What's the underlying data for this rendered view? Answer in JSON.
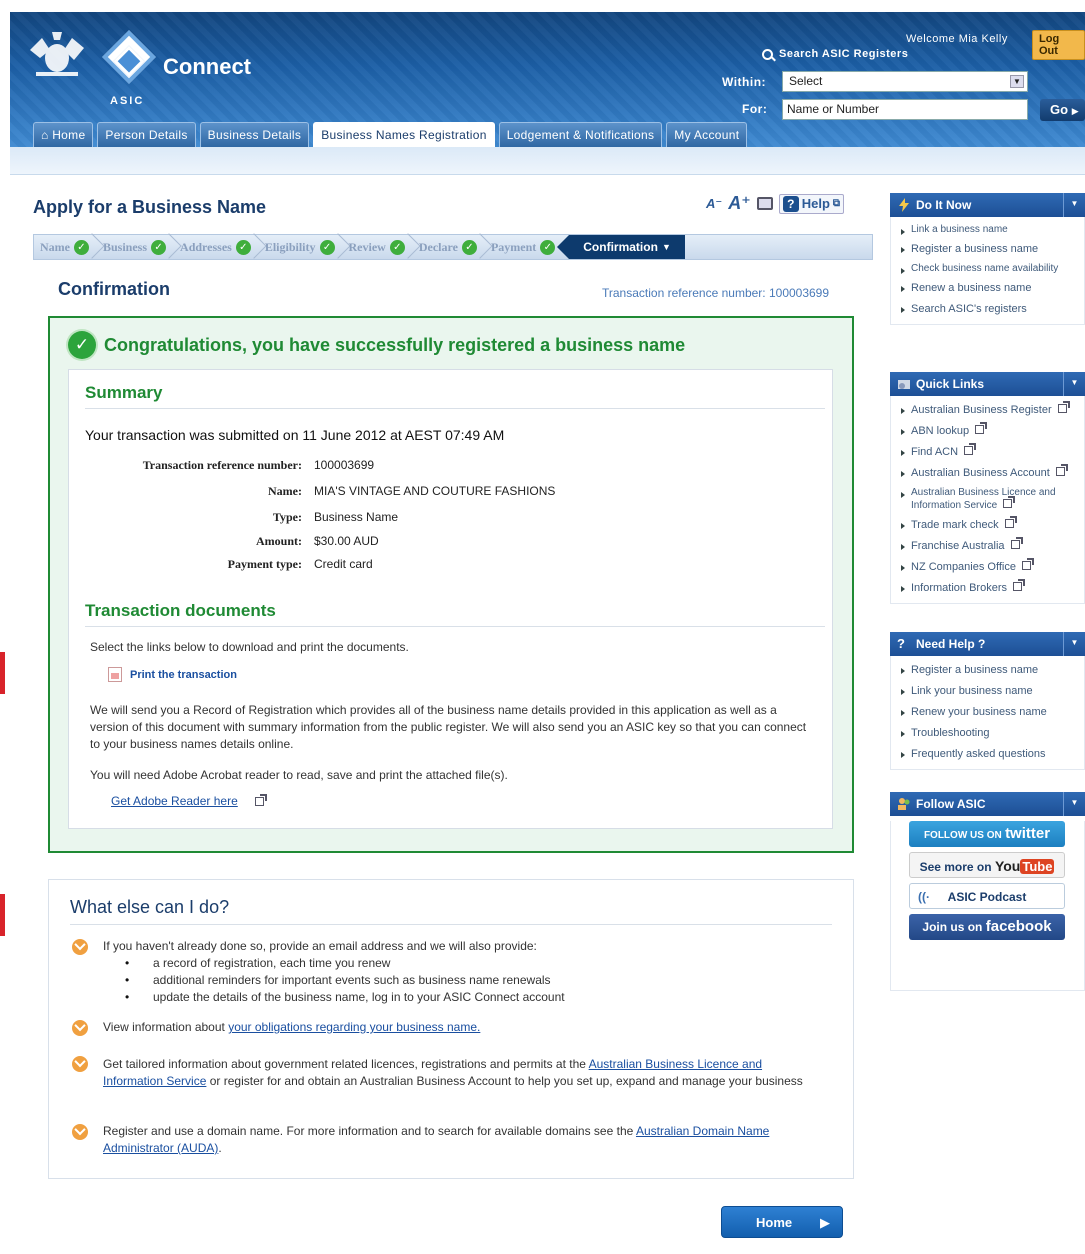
{
  "header": {
    "brand": "Connect",
    "agency": "ASIC",
    "welcome": "Welcome Mia Kelly",
    "logout": "Log Out",
    "search_label": "Search ASIC Registers",
    "within_label": "Within:",
    "within_value": "Select",
    "for_label": "For:",
    "for_placeholder": "Name or Number",
    "go": "Go"
  },
  "tabs": [
    "Home",
    "Person Details",
    "Business Details",
    "Business Names Registration",
    "Lodgement & Notifications",
    "My Account"
  ],
  "active_tab": "Business Names Registration",
  "page": {
    "title": "Apply for a Business Name",
    "help": "Help"
  },
  "steps": [
    "Name",
    "Business",
    "Addresses",
    "Eligibility",
    "Review",
    "Declare",
    "Payment"
  ],
  "active_step": "Confirmation",
  "confirmation": {
    "title": "Confirmation",
    "ref_text": "Transaction reference number: 100003699",
    "congrats": "Congratulations, you have successfully registered a business name",
    "summary_heading": "Summary",
    "submitted": "Your transaction was submitted on 11 June 2012 at AEST 07:49 AM",
    "fields": [
      {
        "label": "Transaction reference number:",
        "value": "100003699"
      },
      {
        "label": "Name:",
        "value": "MIA'S VINTAGE AND COUTURE FASHIONS"
      },
      {
        "label": "Type:",
        "value": "Business Name"
      },
      {
        "label": "Amount:",
        "value": "$30.00 AUD"
      },
      {
        "label": "Payment type:",
        "value": "Credit card"
      }
    ],
    "docs_heading": "Transaction documents",
    "docs_intro": "Select the links below to download and print the documents.",
    "print_link": "Print the transaction",
    "record_para": "We will send you a Record of Registration which provides all of the business name details provided in this application as well as a version of this document with summary information from the public register. We will also send you an ASIC key so that you can connect to your business names details online.",
    "adobe_para": "You will need Adobe Acrobat reader to read, save and print the attached file(s).",
    "adobe_link": "Get Adobe Reader here"
  },
  "what_else": {
    "title": "What else can I do?",
    "item1": "If you haven't already done so, provide an email address and we will also provide:",
    "item1_subs": [
      "a record of registration, each time you renew",
      "additional reminders for important events such as business name renewals",
      "update the details of the business name, log in to your ASIC Connect account"
    ],
    "item2_pre": "View information about ",
    "item2_link": "your obligations regarding your business name.",
    "item3_pre": "Get tailored information about government related licences, registrations and permits at the ",
    "item3_link": "Australian Business Licence and Information Service",
    "item3_post": " or register for and obtain an Australian Business Account to help you set up, expand and manage your business",
    "item4_pre": "Register and use a domain name. For more information and to search for available domains see the ",
    "item4_link": "Australian Domain Name Administrator (AUDA)",
    "item4_post": "."
  },
  "home_button": "Home",
  "sidebar": {
    "do_it_now": {
      "title": "Do It Now",
      "items": [
        "Link a business name",
        "Register a business name",
        "Check business name availability",
        "Renew a business name",
        "Search ASIC's registers"
      ]
    },
    "quick_links": {
      "title": "Quick Links",
      "items": [
        "Australian Business Register",
        "ABN lookup",
        "Find ACN",
        "Australian Business Account",
        "Australian Business Licence and Information Service",
        "Trade mark check",
        "Franchise Australia",
        "NZ Companies Office",
        "Information Brokers"
      ]
    },
    "need_help": {
      "title": "Need Help ?",
      "items": [
        "Register a business name",
        "Link your business name",
        "Renew your business name",
        "Troubleshooting",
        "Frequently asked questions"
      ]
    },
    "follow": {
      "title": "Follow ASIC",
      "twitter_pre": "FOLLOW US ON",
      "twitter_brand": "twitter",
      "youtube_pre": "See more on",
      "youtube_brand_a": "You",
      "youtube_brand_b": "Tube",
      "podcast": "ASIC Podcast",
      "facebook_pre": "Join us on",
      "facebook_brand": "facebook"
    }
  },
  "colors": {
    "header": "#1c5fa6",
    "success": "#1f8a34",
    "title": "#1b3d6b",
    "step_active": "#0d3a6d"
  }
}
